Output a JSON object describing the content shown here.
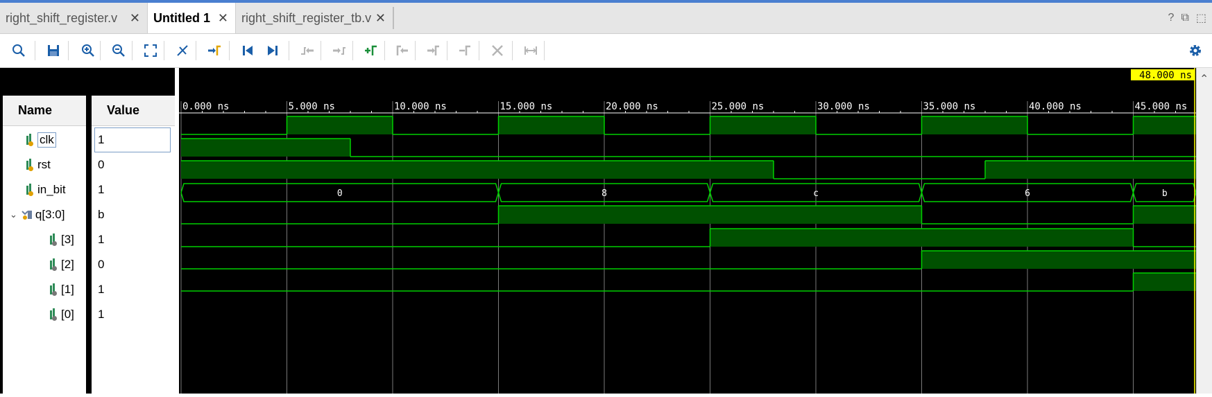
{
  "tabs": [
    {
      "label": "right_shift_register.v",
      "active": false
    },
    {
      "label": "Untitled 1",
      "active": true
    },
    {
      "label": "right_shift_register_tb.v",
      "active": false
    }
  ],
  "tabbar_right": {
    "help": "?",
    "restore": "⧉",
    "maximize": "⬚"
  },
  "toolbar": [
    {
      "name": "search-icon",
      "glyph": "🔍"
    },
    {
      "name": "save-icon",
      "glyph": "💾"
    },
    {
      "name": "zoom-in-icon",
      "glyph": "⊕"
    },
    {
      "name": "zoom-out-icon",
      "glyph": "⊖"
    },
    {
      "name": "zoom-fit-icon",
      "glyph": "⤢"
    },
    {
      "name": "marker-icon",
      "glyph": "✂"
    },
    {
      "name": "go-to-cursor-icon",
      "glyph": "⇥"
    },
    {
      "name": "go-to-start-icon",
      "glyph": "⏮"
    },
    {
      "name": "go-to-end-icon",
      "glyph": "⏭"
    },
    {
      "name": "previous-transition-icon",
      "glyph": "⇤"
    },
    {
      "name": "next-transition-icon",
      "glyph": "⇥"
    },
    {
      "name": "add-marker-icon",
      "glyph": "+"
    },
    {
      "name": "previous-marker-icon",
      "glyph": "⇤"
    },
    {
      "name": "next-marker-icon",
      "glyph": "⇥"
    },
    {
      "name": "swap-cursors-icon",
      "glyph": "⌐"
    },
    {
      "name": "delete-marker-icon",
      "glyph": "✕"
    },
    {
      "name": "snap-to-transition-icon",
      "glyph": "⊢"
    }
  ],
  "settings_icon": "⚙",
  "columns": {
    "name": "Name",
    "value": "Value"
  },
  "signals": [
    {
      "name": "clk",
      "value": "1",
      "type": "in"
    },
    {
      "name": "rst",
      "value": "0",
      "type": "in"
    },
    {
      "name": "in_bit",
      "value": "1",
      "type": "in"
    },
    {
      "name": "q[3:0]",
      "value": "b",
      "type": "bus"
    },
    {
      "name": "[3]",
      "value": "1",
      "type": "bit"
    },
    {
      "name": "[2]",
      "value": "0",
      "type": "bit"
    },
    {
      "name": "[1]",
      "value": "1",
      "type": "bit"
    },
    {
      "name": "[0]",
      "value": "1",
      "type": "bit"
    }
  ],
  "cursor_label": "48.000 ns",
  "time_ticks": [
    "0.000 ns",
    "5.000 ns",
    "10.000 ns",
    "15.000 ns",
    "20.000 ns",
    "25.000 ns",
    "30.000 ns",
    "35.000 ns",
    "40.000 ns",
    "45.000 ns"
  ],
  "waveforms": {
    "time_start": 0,
    "time_end": 48,
    "clk": [
      [
        0,
        0
      ],
      [
        5,
        1
      ],
      [
        10,
        0
      ],
      [
        15,
        1
      ],
      [
        20,
        0
      ],
      [
        25,
        1
      ],
      [
        30,
        0
      ],
      [
        35,
        1
      ],
      [
        40,
        0
      ],
      [
        45,
        1
      ]
    ],
    "rst": [
      [
        0,
        1
      ],
      [
        8,
        0
      ]
    ],
    "in_bit": [
      [
        0,
        1
      ],
      [
        28,
        0
      ],
      [
        38,
        1
      ]
    ],
    "q_bus": [
      [
        0,
        "0"
      ],
      [
        15,
        "8"
      ],
      [
        25,
        "c"
      ],
      [
        35,
        "6"
      ],
      [
        45,
        "b"
      ]
    ],
    "q3": [
      [
        0,
        0
      ],
      [
        15,
        1
      ],
      [
        35,
        0
      ],
      [
        45,
        1
      ]
    ],
    "q2": [
      [
        0,
        0
      ],
      [
        25,
        1
      ],
      [
        45,
        0
      ]
    ],
    "q1": [
      [
        0,
        0
      ],
      [
        35,
        1
      ]
    ],
    "q0": [
      [
        0,
        0
      ],
      [
        45,
        1
      ]
    ]
  },
  "colors": {
    "wave": "#00d000",
    "fill": "#005000",
    "grid": "#7a7a7a",
    "cursor_bg": "#ffff00",
    "cursor_line": "#ffff00"
  }
}
